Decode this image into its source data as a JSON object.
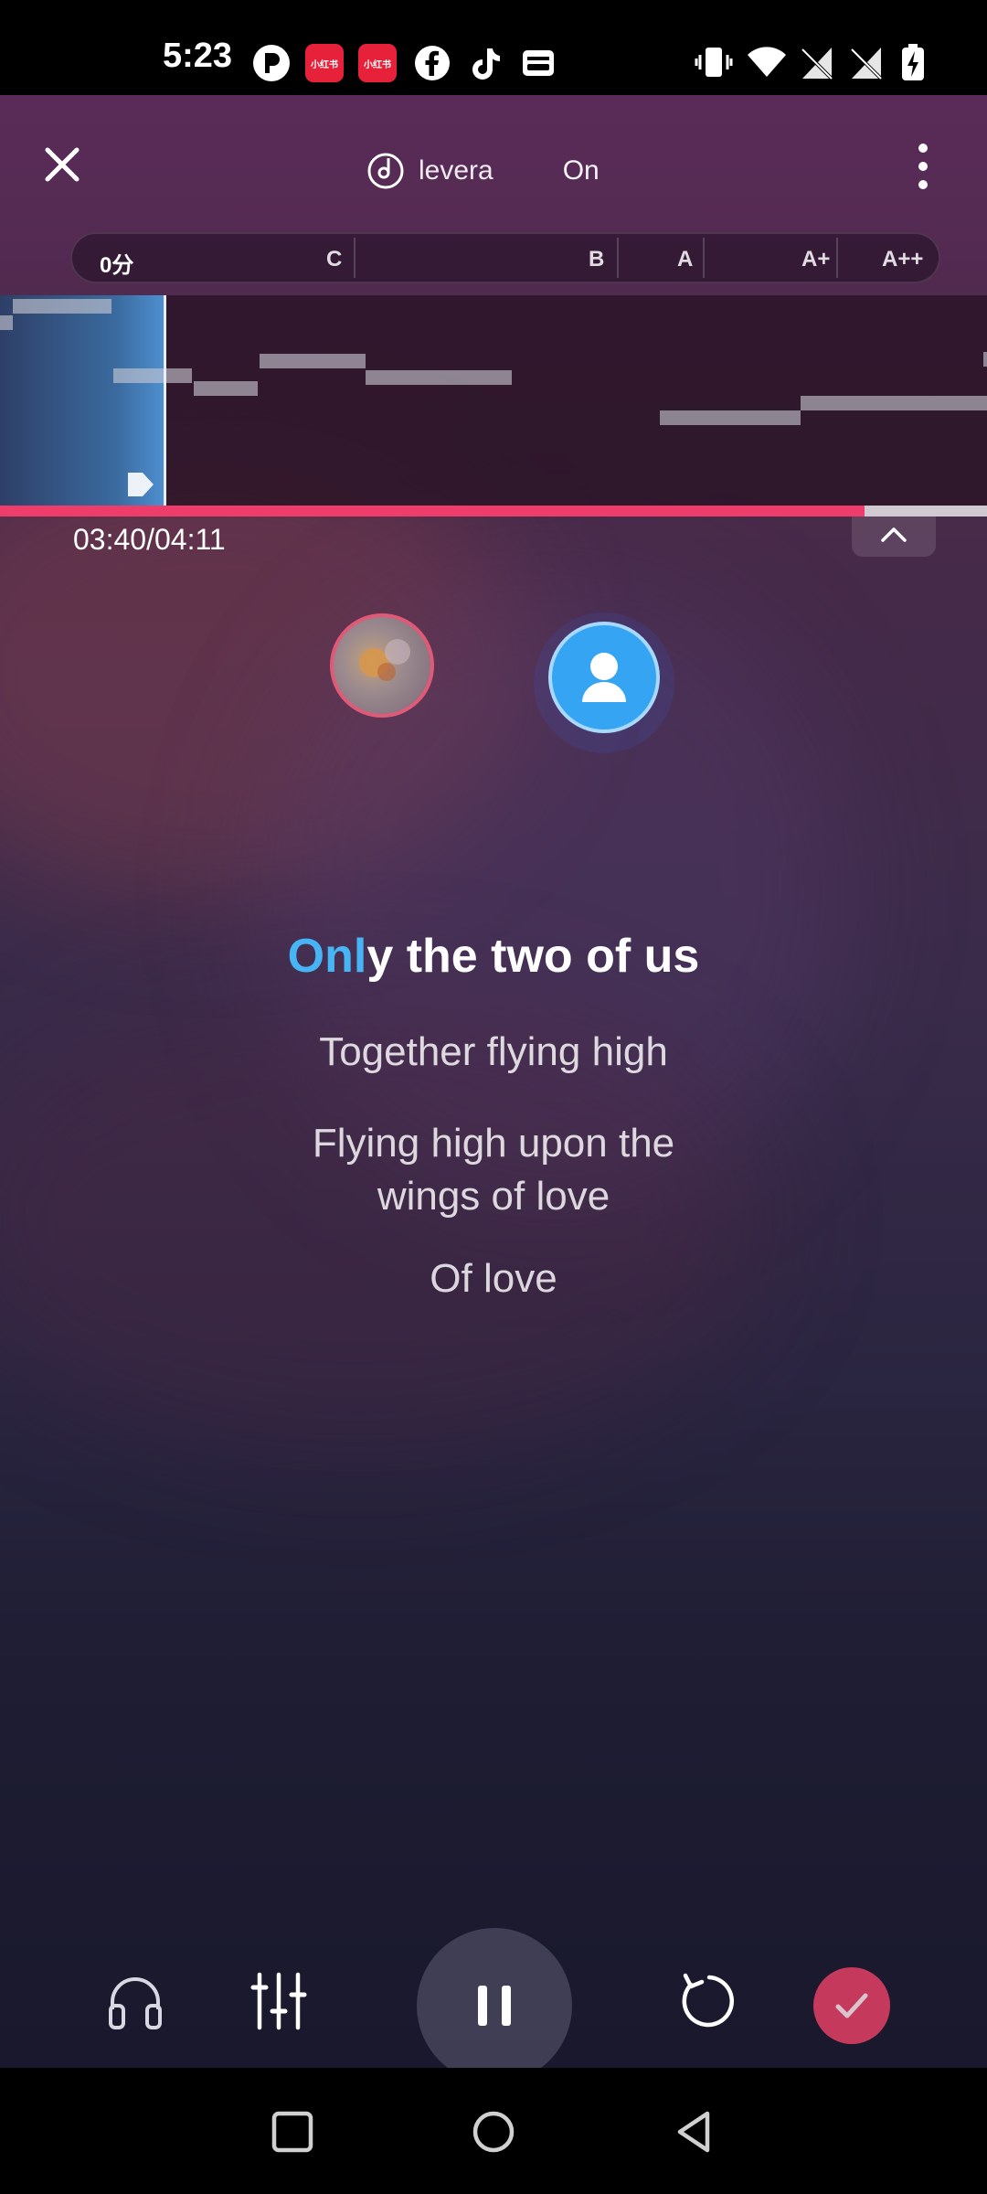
{
  "status_bar": {
    "time": "5:23",
    "apps": [
      "p-app-icon",
      "xiaohongshu-icon",
      "xiaohongshu-icon",
      "facebook-icon",
      "tiktok-icon",
      "wallet-icon"
    ],
    "app_badge_text": "小红书"
  },
  "header": {
    "track_title_part1": "levera",
    "track_title_part2": "On",
    "close_icon": "close-icon",
    "more_icon": "more-vert-icon"
  },
  "score_bar": {
    "score": "0分",
    "grades": [
      "C",
      "B",
      "A",
      "A+",
      "A++"
    ]
  },
  "playback": {
    "time": "03:40/04:11",
    "progress": 0.876
  },
  "lyrics": {
    "current_sung": "Onl",
    "current_rest": "y the two of us",
    "next": [
      "Together flying high",
      "Flying high upon the",
      "wings of love",
      "Of love"
    ]
  },
  "controls": {
    "icons": [
      "headphones-icon",
      "mixer-icon",
      "pause-icon",
      "restart-icon",
      "check-icon"
    ]
  },
  "nav_bar": {
    "icons": [
      "recents-icon",
      "home-icon",
      "back-icon"
    ]
  },
  "colors": {
    "accent_blue": "#47b5f5",
    "progress_pink": "#ee3d6a",
    "finish_red": "#c53a5c"
  }
}
